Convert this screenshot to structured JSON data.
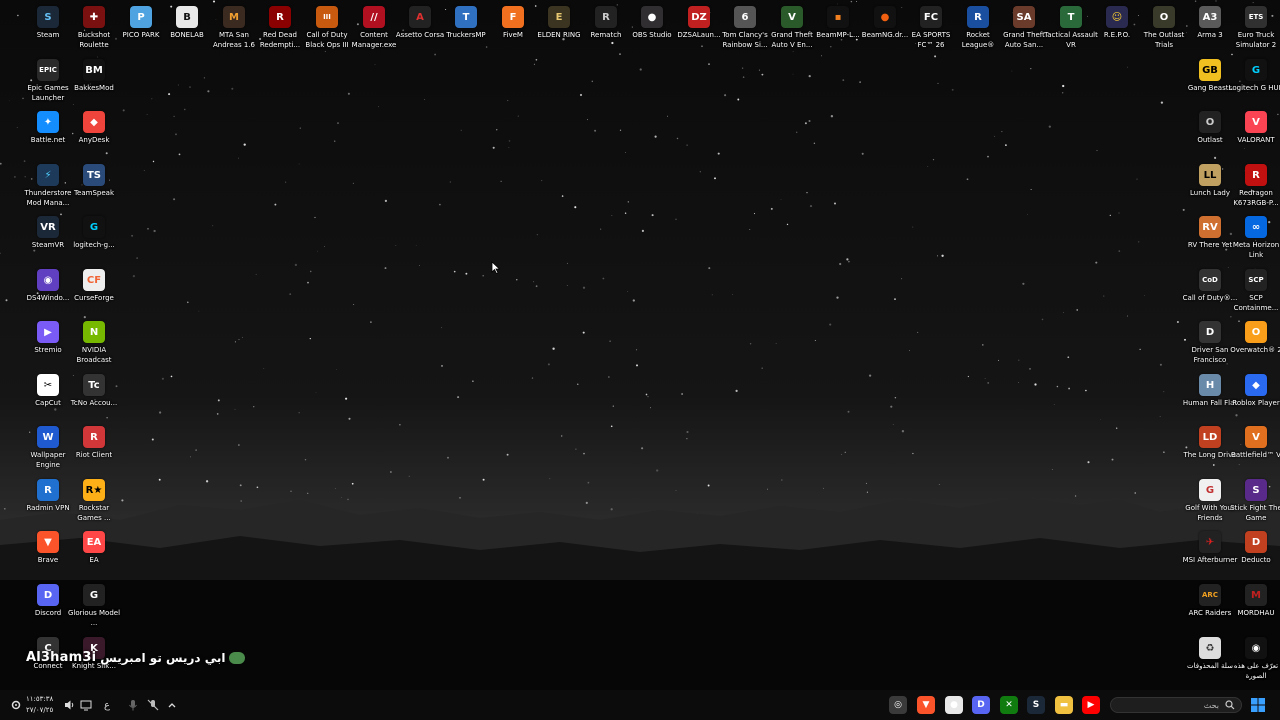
{
  "desktop_icons": [
    {
      "label": "Steam",
      "name": "steam-icon",
      "bg": "#1b2838",
      "fg": "#66c0f4",
      "glyph": "S"
    },
    {
      "label": "Buckshot Roulette",
      "name": "buckshot-roulette-icon",
      "bg": "#7a1010",
      "fg": "#fff",
      "glyph": "✚"
    },
    {
      "label": "PICO PARK",
      "name": "pico-park-icon",
      "bg": "#4fa3e0",
      "fg": "#fff",
      "glyph": "P"
    },
    {
      "label": "BONELAB",
      "name": "bonelab-icon",
      "bg": "#e8e8e8",
      "fg": "#111",
      "glyph": "B"
    },
    {
      "label": "MTA San Andreas 1.6",
      "name": "mta-icon",
      "bg": "#3a2a20",
      "fg": "#f0a030",
      "glyph": "M"
    },
    {
      "label": "Red Dead Redempti...",
      "name": "red-dead-icon",
      "bg": "#8b0000",
      "fg": "#fff",
      "glyph": "R"
    },
    {
      "label": "Call of Duty Black Ops III",
      "name": "cod-bo3-icon",
      "bg": "#c85a10",
      "fg": "#fff",
      "glyph": "III"
    },
    {
      "label": "Content Manager.exe",
      "name": "content-manager-icon",
      "bg": "#b01020",
      "fg": "#fff",
      "glyph": "//"
    },
    {
      "label": "Assetto Corsa",
      "name": "assetto-corsa-icon",
      "bg": "#222",
      "fg": "#e03030",
      "glyph": "A"
    },
    {
      "label": "TruckersMP",
      "name": "truckersmp-icon",
      "bg": "#3070c0",
      "fg": "#fff",
      "glyph": "T"
    },
    {
      "label": "FiveM",
      "name": "fivem-icon",
      "bg": "#f07020",
      "fg": "#fff",
      "glyph": "F"
    },
    {
      "label": "ELDEN RING",
      "name": "elden-ring-icon",
      "bg": "#3a3420",
      "fg": "#e8c870",
      "glyph": "E"
    },
    {
      "label": "Rematch",
      "name": "rematch-icon",
      "bg": "#222",
      "fg": "#ccc",
      "glyph": "R"
    },
    {
      "label": "OBS Studio",
      "name": "obs-icon",
      "bg": "#302e31",
      "fg": "#fff",
      "glyph": "●"
    },
    {
      "label": "DZSALaun...",
      "name": "dzsa-icon",
      "bg": "#c02020",
      "fg": "#fff",
      "glyph": "DZ"
    },
    {
      "label": "Tom Clancy's Rainbow Si...",
      "name": "rainbow-six-icon",
      "bg": "#555",
      "fg": "#fff",
      "glyph": "6"
    },
    {
      "label": "Grand Theft Auto V En...",
      "name": "gta-v-icon",
      "bg": "#2a5a2a",
      "fg": "#fff",
      "glyph": "V"
    },
    {
      "label": "BeamMP-L...",
      "name": "beammp-icon",
      "bg": "#111",
      "fg": "#f08020",
      "glyph": "▪"
    },
    {
      "label": "BeamNG.dr...",
      "name": "beamng-icon",
      "bg": "#111",
      "fg": "#f06010",
      "glyph": "●"
    },
    {
      "label": "EA SPORTS FC™ 26",
      "name": "ea-fc-icon",
      "bg": "#222",
      "fg": "#fff",
      "glyph": "FC"
    },
    {
      "label": "Rocket League®",
      "name": "rocket-league-icon",
      "bg": "#1a4fa0",
      "fg": "#fff",
      "glyph": "R"
    },
    {
      "label": "Grand Theft Auto San...",
      "name": "gta-sa-icon",
      "bg": "#6a3a2a",
      "fg": "#fff",
      "glyph": "SA"
    },
    {
      "label": "Tactical Assault VR",
      "name": "tactical-assault-icon",
      "bg": "#2a6a3a",
      "fg": "#fff",
      "glyph": "T"
    },
    {
      "label": "R.E.P.O.",
      "name": "repo-icon",
      "bg": "#2a2a50",
      "fg": "#ffd030",
      "glyph": "☺"
    },
    {
      "label": "The Outlast Trials",
      "name": "outlast-trials-icon",
      "bg": "#3a3a2a",
      "fg": "#fff",
      "glyph": "O"
    },
    {
      "label": "Arma 3",
      "name": "arma3-icon",
      "bg": "#5a5a5a",
      "fg": "#fff",
      "glyph": "A3"
    },
    {
      "label": "Euro Truck Simulator 2",
      "name": "ets2-icon",
      "bg": "#303030",
      "fg": "#fff",
      "glyph": "ETS"
    },
    {
      "label": "Epic Games Launcher",
      "name": "epic-games-icon",
      "bg": "#2a2a2a",
      "fg": "#fff",
      "glyph": "EPIC"
    },
    {
      "label": "BakkesMod",
      "name": "bakkesmod-icon",
      "bg": "#111",
      "fg": "#fff",
      "glyph": "BM"
    },
    {
      "label": "Battle.net",
      "name": "battlenet-icon",
      "bg": "#148eff",
      "fg": "#fff",
      "glyph": "✦"
    },
    {
      "label": "AnyDesk",
      "name": "anydesk-icon",
      "bg": "#ef443b",
      "fg": "#fff",
      "glyph": "◆"
    },
    {
      "label": "Thunderstore Mod Mana...",
      "name": "thunderstore-icon",
      "bg": "#1e3a5a",
      "fg": "#4fd0ff",
      "glyph": "⚡"
    },
    {
      "label": "TeamSpeak",
      "name": "teamspeak-icon",
      "bg": "#2a4a7a",
      "fg": "#fff",
      "glyph": "TS"
    },
    {
      "label": "SteamVR",
      "name": "steamvr-icon",
      "bg": "#1b2838",
      "fg": "#fff",
      "glyph": "VR"
    },
    {
      "label": "logitech-g...",
      "name": "logitech-g-icon",
      "bg": "#111",
      "fg": "#00d0ff",
      "glyph": "G"
    },
    {
      "label": "DS4Windo...",
      "name": "ds4windows-icon",
      "bg": "#6040c0",
      "fg": "#fff",
      "glyph": "◉"
    },
    {
      "label": "CurseForge",
      "name": "curseforge-icon",
      "bg": "#eee",
      "fg": "#f16436",
      "glyph": "CF"
    },
    {
      "label": "Stremio",
      "name": "stremio-icon",
      "bg": "#7b5bf5",
      "fg": "#fff",
      "glyph": "▶"
    },
    {
      "label": "NVIDIA Broadcast",
      "name": "nvidia-broadcast-icon",
      "bg": "#76b900",
      "fg": "#fff",
      "glyph": "N"
    },
    {
      "label": "CapCut",
      "name": "capcut-icon",
      "bg": "#fff",
      "fg": "#000",
      "glyph": "✂"
    },
    {
      "label": "TcNo Accou...",
      "name": "tcno-icon",
      "bg": "#333",
      "fg": "#fff",
      "glyph": "Tc"
    },
    {
      "label": "Wallpaper Engine",
      "name": "wallpaper-engine-icon",
      "bg": "#1f5ad0",
      "fg": "#fff",
      "glyph": "W"
    },
    {
      "label": "Riot Client",
      "name": "riot-client-icon",
      "bg": "#d13639",
      "fg": "#fff",
      "glyph": "R"
    },
    {
      "label": "Radmin VPN",
      "name": "radmin-vpn-icon",
      "bg": "#2070d0",
      "fg": "#fff",
      "glyph": "R"
    },
    {
      "label": "Rockstar Games ...",
      "name": "rockstar-icon",
      "bg": "#fcaf17",
      "fg": "#000",
      "glyph": "R★"
    },
    {
      "label": "Brave",
      "name": "brave-icon",
      "bg": "#fb542b",
      "fg": "#fff",
      "glyph": "▼"
    },
    {
      "label": "EA",
      "name": "ea-icon",
      "bg": "#ff4747",
      "fg": "#fff",
      "glyph": "EA"
    },
    {
      "label": "Discord",
      "name": "discord-icon",
      "bg": "#5865f2",
      "fg": "#fff",
      "glyph": "D"
    },
    {
      "label": "Glorious Model ...",
      "name": "glorious-icon",
      "bg": "#222",
      "fg": "#fff",
      "glyph": "G"
    },
    {
      "label": "Connect",
      "name": "connect-icon",
      "bg": "#333",
      "fg": "#fff",
      "glyph": "C"
    },
    {
      "label": "Knight Silk...",
      "name": "hollow-knight-icon",
      "bg": "#3a1a2a",
      "fg": "#fff",
      "glyph": "K"
    },
    {
      "label": "Gang Beasts",
      "name": "gang-beasts-icon",
      "bg": "#f0c020",
      "fg": "#000",
      "glyph": "GB"
    },
    {
      "label": "Logitech G HUB",
      "name": "logitech-g-hub-icon",
      "bg": "#111",
      "fg": "#00d0ff",
      "glyph": "G"
    },
    {
      "label": "Outlast",
      "name": "outlast-icon",
      "bg": "#222",
      "fg": "#ccc",
      "glyph": "O"
    },
    {
      "label": "VALORANT",
      "name": "valorant-icon",
      "bg": "#fa4454",
      "fg": "#fff",
      "glyph": "V"
    },
    {
      "label": "Lunch Lady",
      "name": "lunch-lady-icon",
      "bg": "#c0a060",
      "fg": "#000",
      "glyph": "LL"
    },
    {
      "label": "Redragon K673RGB-P...",
      "name": "redragon-icon",
      "bg": "#c01010",
      "fg": "#fff",
      "glyph": "R"
    },
    {
      "label": "RV There Yet",
      "name": "rv-there-yet-icon",
      "bg": "#d07030",
      "fg": "#fff",
      "glyph": "RV"
    },
    {
      "label": "Meta Horizon Link",
      "name": "meta-horizon-icon",
      "bg": "#0668e1",
      "fg": "#fff",
      "glyph": "∞"
    },
    {
      "label": "Call of Duty®...",
      "name": "cod-icon",
      "bg": "#333",
      "fg": "#fff",
      "glyph": "CoD"
    },
    {
      "label": "SCP Containme...",
      "name": "scp-icon",
      "bg": "#222",
      "fg": "#fff",
      "glyph": "SCP"
    },
    {
      "label": "Driver San Francisco",
      "name": "driver-sf-icon",
      "bg": "#333",
      "fg": "#fff",
      "glyph": "D"
    },
    {
      "label": "Overwatch® 2",
      "name": "overwatch-icon",
      "bg": "#f99e1a",
      "fg": "#fff",
      "glyph": "O"
    },
    {
      "label": "Human Fall Flat",
      "name": "human-fall-flat-icon",
      "bg": "#6a8aaa",
      "fg": "#fff",
      "glyph": "H"
    },
    {
      "label": "Roblox Player",
      "name": "roblox-icon",
      "bg": "#2a6af0",
      "fg": "#fff",
      "glyph": "◆"
    },
    {
      "label": "The Long Drive",
      "name": "long-drive-icon",
      "bg": "#c04020",
      "fg": "#fff",
      "glyph": "LD"
    },
    {
      "label": "Battlefield™ V",
      "name": "battlefield-icon",
      "bg": "#e07020",
      "fg": "#fff",
      "glyph": "V"
    },
    {
      "label": "Golf With Your Friends",
      "name": "golf-friends-icon",
      "bg": "#f0f0f0",
      "fg": "#c03030",
      "glyph": "G"
    },
    {
      "label": "Stick Fight The Game",
      "name": "stick-fight-icon",
      "bg": "#5a2a8a",
      "fg": "#fff",
      "glyph": "S"
    },
    {
      "label": "MSI Afterburner",
      "name": "msi-afterburner-icon",
      "bg": "#222",
      "fg": "#e02020",
      "glyph": "✈"
    },
    {
      "label": "Deducto",
      "name": "deducto-icon",
      "bg": "#c04020",
      "fg": "#fff",
      "glyph": "D"
    },
    {
      "label": "ARC Raiders",
      "name": "arc-raiders-icon",
      "bg": "#222",
      "fg": "#f0a020",
      "glyph": "ARC"
    },
    {
      "label": "MORDHAU",
      "name": "mordhau-icon",
      "bg": "#222",
      "fg": "#c02020",
      "glyph": "M"
    },
    {
      "label": "سلة المحذوفات",
      "name": "recycle-bin-icon",
      "bg": "#ddd",
      "fg": "#333",
      "glyph": "♻"
    },
    {
      "label": "تعرّف على هذه الصورة",
      "name": "learn-about-picture-icon",
      "bg": "#111",
      "fg": "#fff",
      "glyph": "◉"
    }
  ],
  "overlay": {
    "brand": "Al3ham3i",
    "caption": "ابي دريس تو امبريس"
  },
  "taskbar": {
    "clock_time": "١١:٥٣:٣٨",
    "clock_date": "٢٧/٠٧/٢٥",
    "language": "ع",
    "search_placeholder": "بحث",
    "search_icon": "search-icon",
    "tray_icons": [
      "settings-icon",
      "volume-icon",
      "display-icon",
      "language-indicator",
      "mic-muted-icon",
      "mic-icon",
      "chevron-up-icon"
    ],
    "pinned_apps": [
      {
        "name": "mod-app-icon",
        "bg": "#3a3a3a",
        "glyph": "◎"
      },
      {
        "name": "brave-taskbar-icon",
        "bg": "#fb542b",
        "glyph": "▼"
      },
      {
        "name": "chrome-icon",
        "bg": "#e8e8e8",
        "glyph": "●"
      },
      {
        "name": "discord-taskbar-icon",
        "bg": "#5865f2",
        "glyph": "D"
      },
      {
        "name": "xbox-icon",
        "bg": "#107c10",
        "glyph": "✕"
      },
      {
        "name": "steam-taskbar-icon",
        "bg": "#1b2838",
        "glyph": "S"
      },
      {
        "name": "file-explorer-icon",
        "bg": "#f0c040",
        "glyph": "▬"
      },
      {
        "name": "youtube-icon",
        "bg": "#ff0000",
        "glyph": "▶"
      }
    ],
    "start_icon": "windows-start-icon"
  }
}
